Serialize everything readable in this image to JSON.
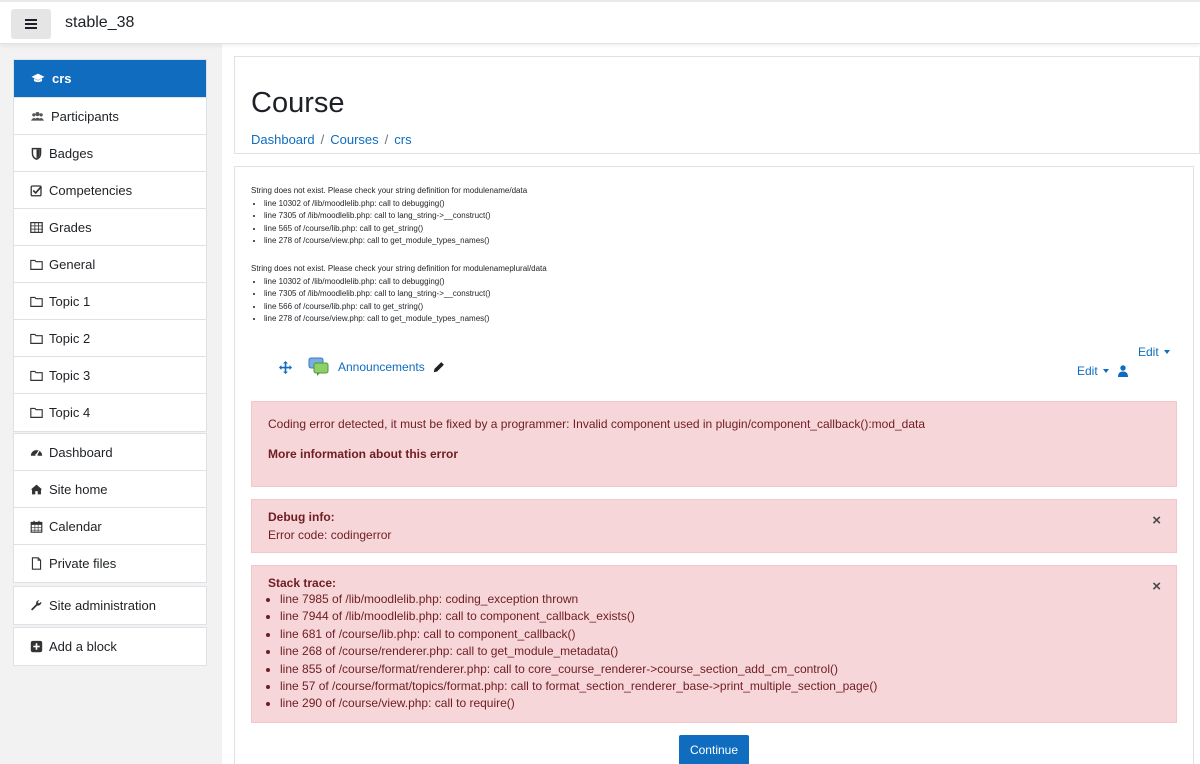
{
  "navbar": {
    "site_name": "stable_38"
  },
  "sidebar": {
    "course_items": [
      {
        "label": "crs",
        "icon": "graduation-cap-icon"
      },
      {
        "label": "Participants",
        "icon": "users-icon"
      },
      {
        "label": "Badges",
        "icon": "shield-icon"
      },
      {
        "label": "Competencies",
        "icon": "check-square-icon"
      },
      {
        "label": "Grades",
        "icon": "table-icon"
      },
      {
        "label": "General",
        "icon": "folder-icon"
      },
      {
        "label": "Topic 1",
        "icon": "folder-icon"
      },
      {
        "label": "Topic 2",
        "icon": "folder-icon"
      },
      {
        "label": "Topic 3",
        "icon": "folder-icon"
      },
      {
        "label": "Topic 4",
        "icon": "folder-icon"
      }
    ],
    "site_items": [
      {
        "label": "Dashboard",
        "icon": "tachometer-icon"
      },
      {
        "label": "Site home",
        "icon": "home-icon"
      },
      {
        "label": "Calendar",
        "icon": "calendar-icon"
      },
      {
        "label": "Private files",
        "icon": "file-icon"
      }
    ],
    "admin_label": "Site administration",
    "add_block_label": "Add a block"
  },
  "header": {
    "title": "Course",
    "breadcrumb": [
      "Dashboard",
      "Courses",
      "crs"
    ],
    "separator": "/"
  },
  "debug_messages": [
    {
      "message": "String does not exist. Please check your string definition for modulename/data",
      "lines": [
        "line 10302 of /lib/moodlelib.php: call to debugging()",
        "line 7305 of /lib/moodlelib.php: call to lang_string->__construct()",
        "line 565 of /course/lib.php: call to get_string()",
        "line 278 of /course/view.php: call to get_module_types_names()"
      ]
    },
    {
      "message": "String does not exist. Please check your string definition for modulenameplural/data",
      "lines": [
        "line 10302 of /lib/moodlelib.php: call to debugging()",
        "line 7305 of /lib/moodlelib.php: call to lang_string->__construct()",
        "line 566 of /course/lib.php: call to get_string()",
        "line 278 of /course/view.php: call to get_module_types_names()"
      ]
    }
  ],
  "section_edit_label": "Edit",
  "activity": {
    "name": "Announcements",
    "edit_label": "Edit"
  },
  "error": {
    "message": "Coding error detected, it must be fixed by a programmer: Invalid component used in plugin/component_callback():mod_data",
    "more_info": "More information about this error"
  },
  "debug_info": {
    "title": "Debug info:",
    "text": "Error code: codingerror",
    "close": "×"
  },
  "stack_trace": {
    "title": "Stack trace:",
    "close": "×",
    "lines": [
      "line 7985 of /lib/moodlelib.php: coding_exception thrown",
      "line 7944 of /lib/moodlelib.php: call to component_callback_exists()",
      "line 681 of /course/lib.php: call to component_callback()",
      "line 268 of /course/renderer.php: call to get_module_metadata()",
      "line 855 of /course/format/renderer.php: call to core_course_renderer->course_section_add_cm_control()",
      "line 57 of /course/format/topics/format.php: call to format_section_renderer_base->print_multiple_section_page()",
      "line 290 of /course/view.php: call to require()"
    ]
  },
  "continue_label": "Continue",
  "colors": {
    "primary": "#0f6cbf",
    "alert_bg": "#f6d6d8",
    "alert_text": "#6e1d23"
  }
}
